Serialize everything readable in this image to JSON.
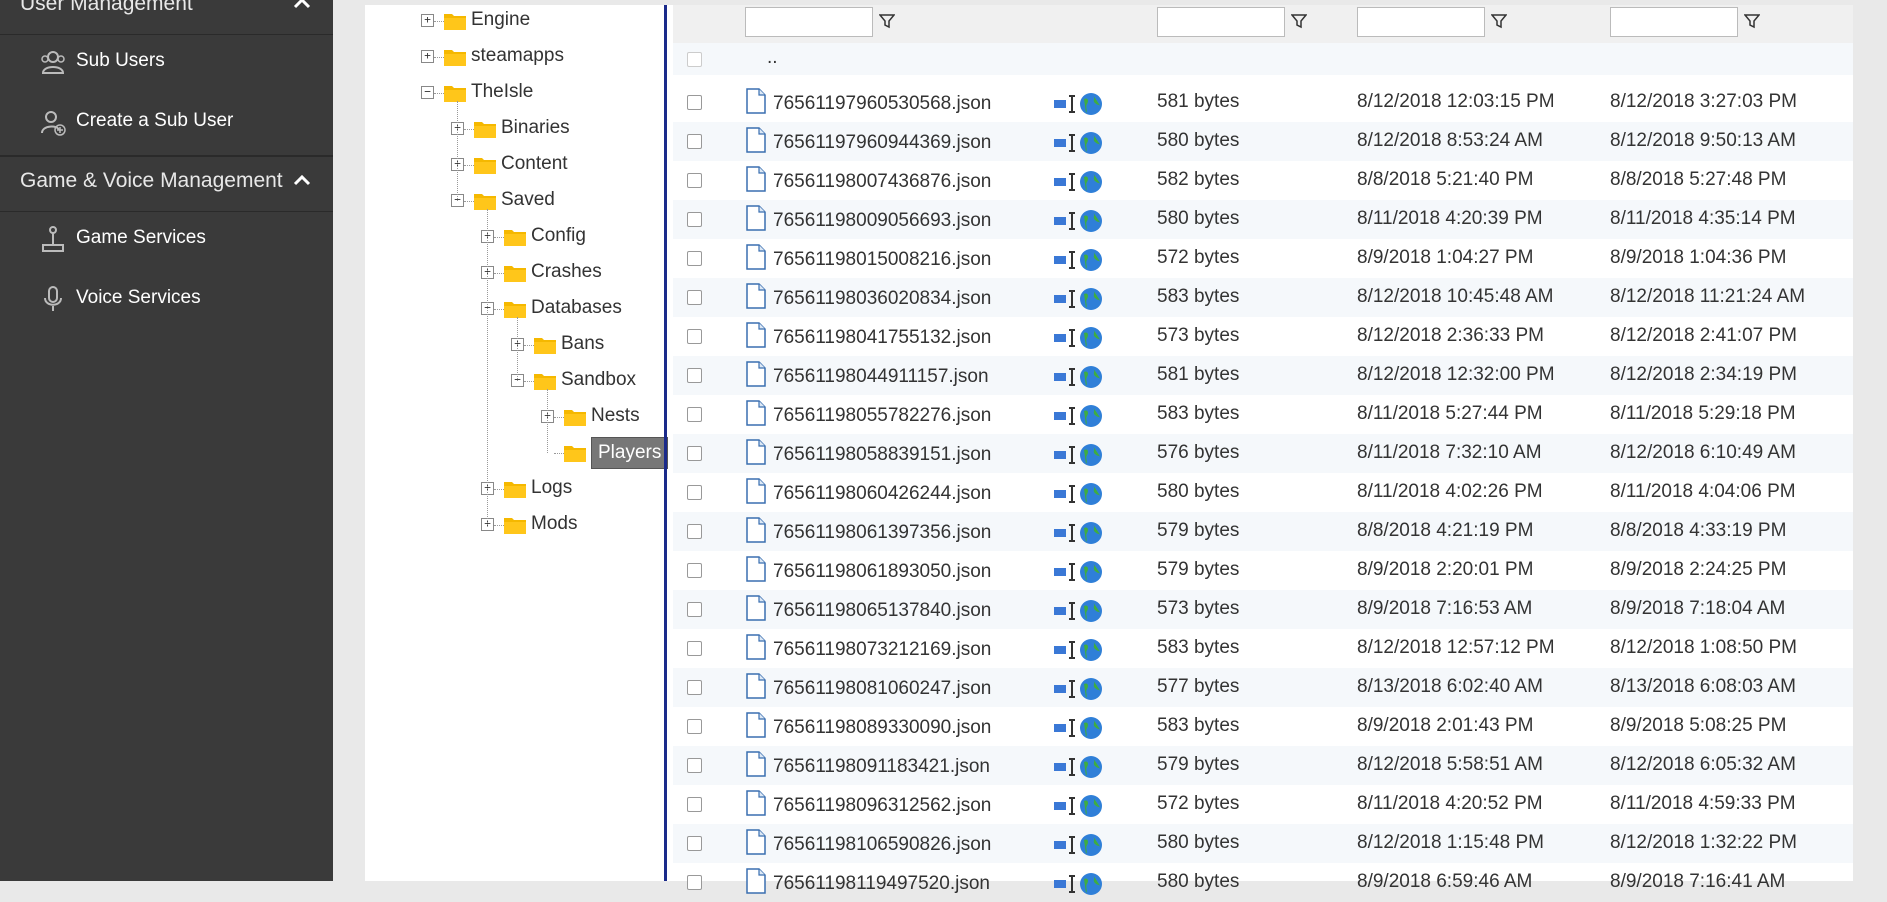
{
  "sidebar": {
    "user_management": {
      "title": "User Management"
    },
    "user_items": [
      {
        "label": "Sub Users",
        "icon": "sub-users-icon"
      },
      {
        "label": "Create a Sub User",
        "icon": "create-sub-user-icon"
      }
    ],
    "game_voice": {
      "title": "Game & Voice Management"
    },
    "game_items": [
      {
        "label": "Game Services",
        "icon": "joystick-icon"
      },
      {
        "label": "Voice Services",
        "icon": "microphone-icon"
      }
    ]
  },
  "tree": {
    "nodes": [
      {
        "name": "Engine",
        "state": "+"
      },
      {
        "name": "steamapps",
        "state": "+"
      },
      {
        "name": "TheIsle",
        "state": "-"
      },
      {
        "name": "Binaries",
        "state": "+"
      },
      {
        "name": "Content",
        "state": "+"
      },
      {
        "name": "Saved",
        "state": "-"
      },
      {
        "name": "Config",
        "state": "+"
      },
      {
        "name": "Crashes",
        "state": "+"
      },
      {
        "name": "Databases",
        "state": "-"
      },
      {
        "name": "Bans",
        "state": "+"
      },
      {
        "name": "Sandbox",
        "state": "-"
      },
      {
        "name": "Nests",
        "state": "+"
      },
      {
        "name": "Players",
        "state": "",
        "selected": true
      },
      {
        "name": "Logs",
        "state": "+"
      },
      {
        "name": "Mods",
        "state": "+"
      }
    ]
  },
  "grid": {
    "updir": "..",
    "filters": [
      "",
      "",
      "",
      ""
    ],
    "rows": [
      {
        "name": "76561197960530568.json",
        "size": "581 bytes",
        "created": "8/12/2018 12:03:15 PM",
        "modified": "8/12/2018 3:27:03 PM"
      },
      {
        "name": "76561197960944369.json",
        "size": "580 bytes",
        "created": "8/12/2018 8:53:24 AM",
        "modified": "8/12/2018 9:50:13 AM"
      },
      {
        "name": "76561198007436876.json",
        "size": "582 bytes",
        "created": "8/8/2018 5:21:40 PM",
        "modified": "8/8/2018 5:27:48 PM"
      },
      {
        "name": "76561198009056693.json",
        "size": "580 bytes",
        "created": "8/11/2018 4:20:39 PM",
        "modified": "8/11/2018 4:35:14 PM"
      },
      {
        "name": "76561198015008216.json",
        "size": "572 bytes",
        "created": "8/9/2018 1:04:27 PM",
        "modified": "8/9/2018 1:04:36 PM"
      },
      {
        "name": "76561198036020834.json",
        "size": "583 bytes",
        "created": "8/12/2018 10:45:48 AM",
        "modified": "8/12/2018 11:21:24 AM"
      },
      {
        "name": "76561198041755132.json",
        "size": "573 bytes",
        "created": "8/12/2018 2:36:33 PM",
        "modified": "8/12/2018 2:41:07 PM"
      },
      {
        "name": "76561198044911157.json",
        "size": "581 bytes",
        "created": "8/12/2018 12:32:00 PM",
        "modified": "8/12/2018 2:34:19 PM"
      },
      {
        "name": "76561198055782276.json",
        "size": "583 bytes",
        "created": "8/11/2018 5:27:44 PM",
        "modified": "8/11/2018 5:29:18 PM"
      },
      {
        "name": "76561198058839151.json",
        "size": "576 bytes",
        "created": "8/11/2018 7:32:10 AM",
        "modified": "8/12/2018 6:10:49 AM"
      },
      {
        "name": "76561198060426244.json",
        "size": "580 bytes",
        "created": "8/11/2018 4:02:26 PM",
        "modified": "8/11/2018 4:04:06 PM"
      },
      {
        "name": "76561198061397356.json",
        "size": "579 bytes",
        "created": "8/8/2018 4:21:19 PM",
        "modified": "8/8/2018 4:33:19 PM"
      },
      {
        "name": "76561198061893050.json",
        "size": "579 bytes",
        "created": "8/9/2018 2:20:01 PM",
        "modified": "8/9/2018 2:24:25 PM"
      },
      {
        "name": "76561198065137840.json",
        "size": "573 bytes",
        "created": "8/9/2018 7:16:53 AM",
        "modified": "8/9/2018 7:18:04 AM"
      },
      {
        "name": "76561198073212169.json",
        "size": "583 bytes",
        "created": "8/12/2018 12:57:12 PM",
        "modified": "8/12/2018 1:08:50 PM"
      },
      {
        "name": "76561198081060247.json",
        "size": "577 bytes",
        "created": "8/13/2018 6:02:40 AM",
        "modified": "8/13/2018 6:08:03 AM"
      },
      {
        "name": "76561198089330090.json",
        "size": "583 bytes",
        "created": "8/9/2018 2:01:43 PM",
        "modified": "8/9/2018 5:08:25 PM"
      },
      {
        "name": "76561198091183421.json",
        "size": "579 bytes",
        "created": "8/12/2018 5:58:51 AM",
        "modified": "8/12/2018 6:05:32 AM"
      },
      {
        "name": "76561198096312562.json",
        "size": "572 bytes",
        "created": "8/11/2018 4:20:52 PM",
        "modified": "8/11/2018 4:59:33 PM"
      },
      {
        "name": "76561198106590826.json",
        "size": "580 bytes",
        "created": "8/12/2018 1:15:48 PM",
        "modified": "8/12/2018 1:32:22 PM"
      },
      {
        "name": "76561198119497520.json",
        "size": "580 bytes",
        "created": "8/9/2018 6:59:46 AM",
        "modified": "8/9/2018 7:16:41 AM"
      }
    ]
  },
  "colors": {
    "sidebar_bg": "#3a3a3a",
    "folder": "#f5b800",
    "splitter": "#1a2a8a",
    "selected_bg": "#777777"
  }
}
